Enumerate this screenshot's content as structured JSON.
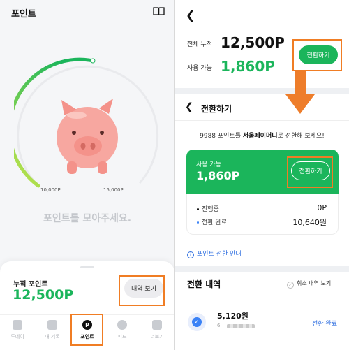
{
  "left": {
    "title": "포인트",
    "gauge": {
      "tick_low": "10,000P",
      "tick_high": "15,000P",
      "progress": 0.55
    },
    "collect_message": "포인트를 모아주세요.",
    "sheet": {
      "accum_label": "누적 포인트",
      "accum_value": "12,500P",
      "history_button": "내역 보기"
    },
    "tabs": [
      {
        "label": "투데이",
        "icon": "calendar-icon"
      },
      {
        "label": "내 기록",
        "icon": "bar-chart-icon"
      },
      {
        "label": "포인트",
        "icon": "point-p-icon",
        "icon_text": "P"
      },
      {
        "label": "피드",
        "icon": "feed-icon"
      },
      {
        "label": "더보기",
        "icon": "menu-icon"
      }
    ]
  },
  "right": {
    "total_label": "전체 누적",
    "total_value": "12,500P",
    "available_label": "사용 가능",
    "available_value": "1,860P",
    "convert_button": "전환하기",
    "convert_title": "전환하기",
    "notice_prefix": "9988 포인트를 ",
    "notice_bold": "서울페이머니",
    "notice_suffix": "로 전환해 보세요!",
    "card": {
      "available_label": "사용 가능",
      "available_value": "1,860P",
      "convert_button": "전환하기",
      "in_progress_label": "진행중",
      "in_progress_value": "0P",
      "completed_label": "전환 완료",
      "completed_value": "10,640원"
    },
    "guide_link": "포인트 전환 안내",
    "history_title": "전환 내역",
    "cancel_history_label": "취소 내역 보기",
    "history_items": [
      {
        "amount": "5,120원",
        "sub": "6",
        "status": "전환 완료"
      }
    ]
  },
  "colors": {
    "brand_green": "#1bb55b",
    "highlight_orange": "#f07d24",
    "link_blue": "#2f6fe0"
  }
}
